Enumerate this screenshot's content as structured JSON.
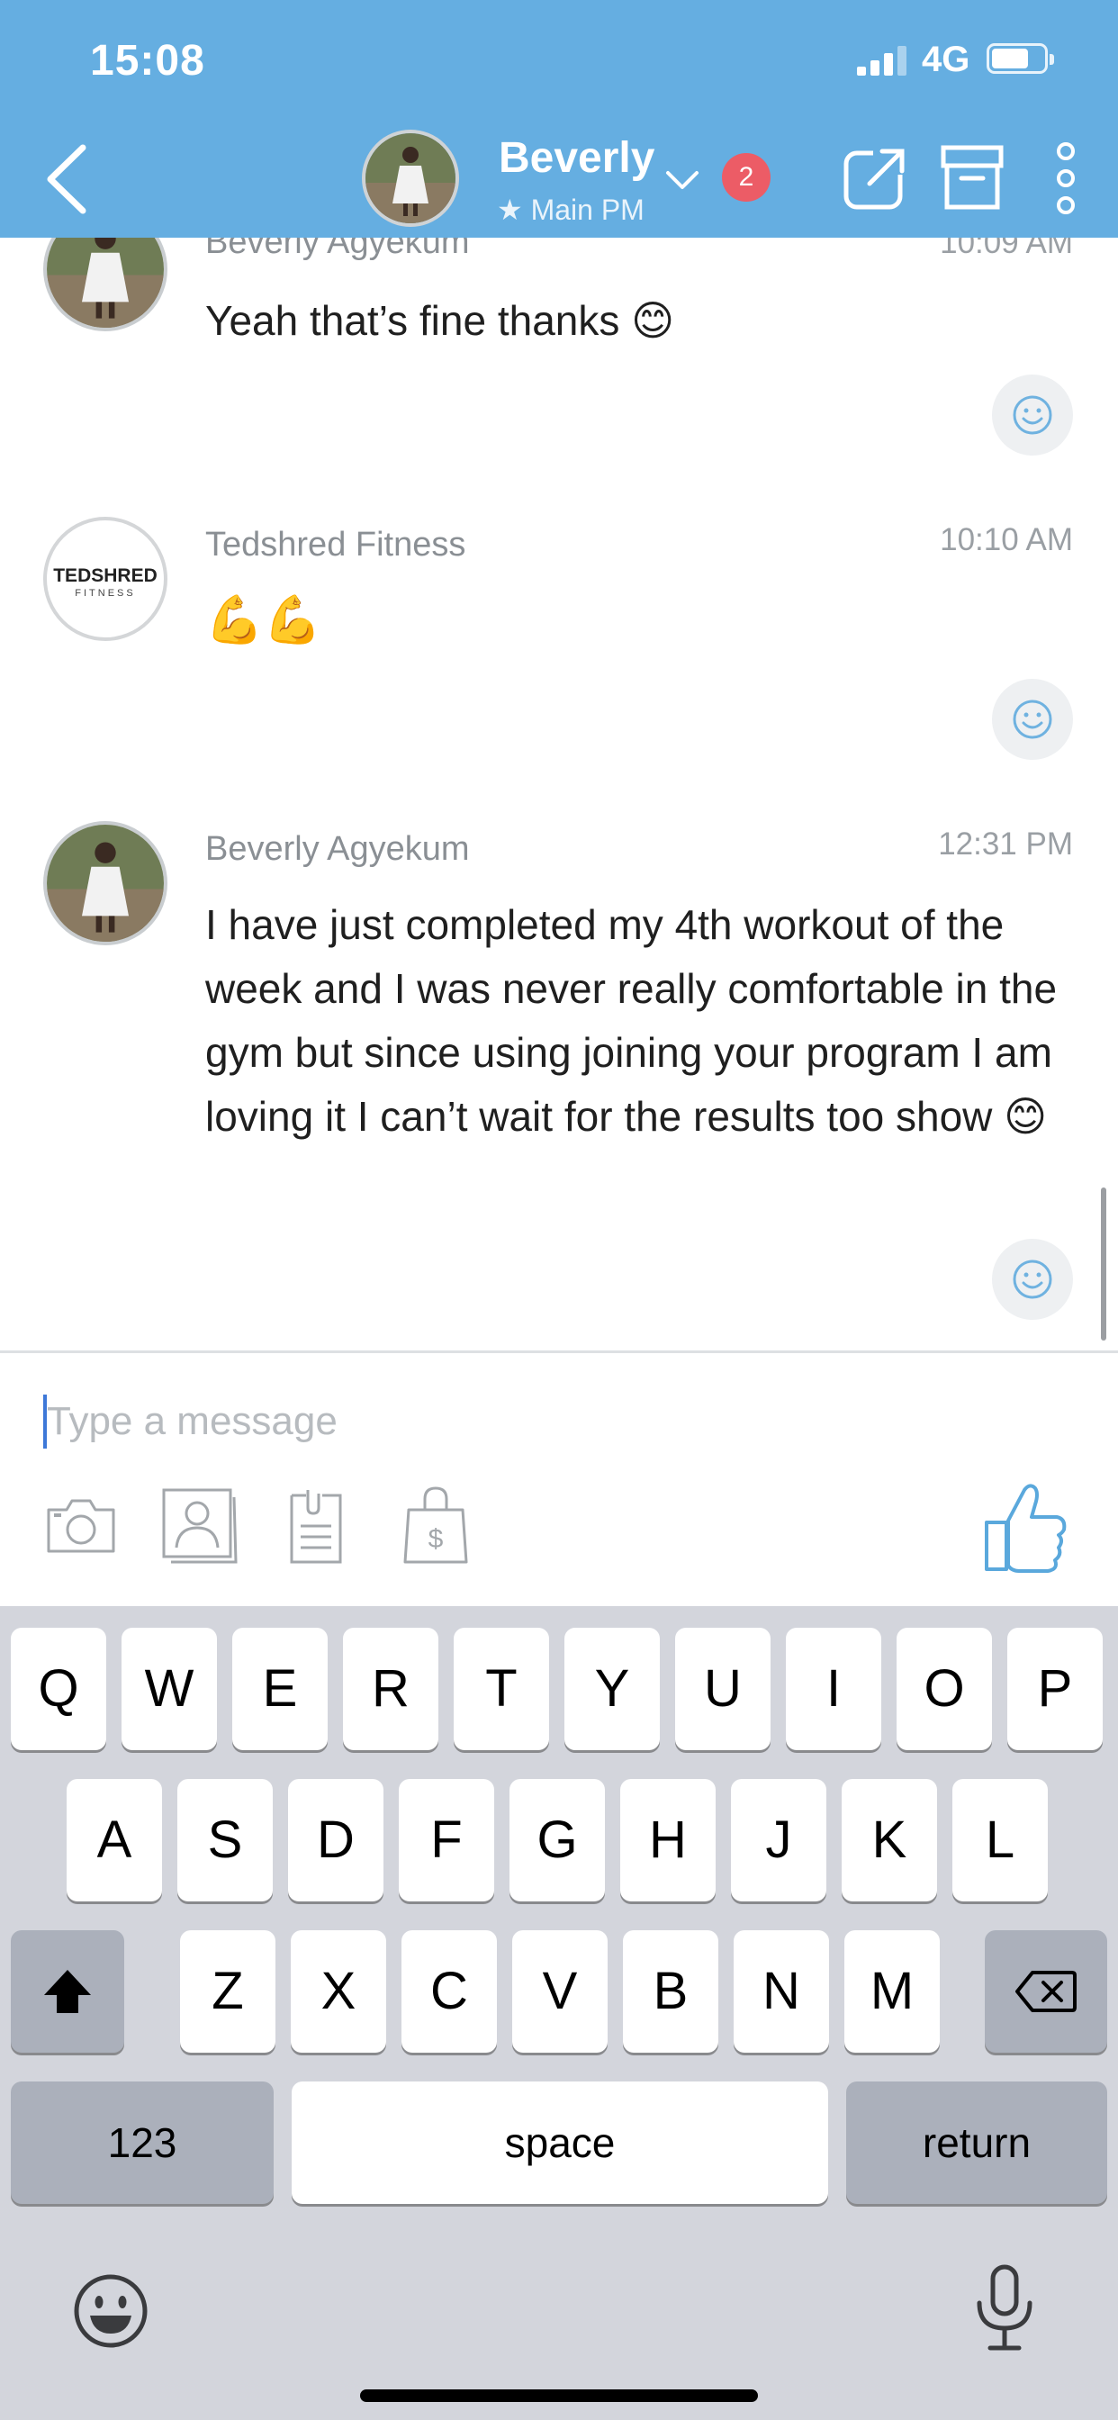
{
  "status_bar": {
    "time": "15:08",
    "network": "4G"
  },
  "header": {
    "name": "Beverly",
    "subtitle": "★ Main PM",
    "badge_count": "2",
    "icons": [
      "back-chevron-icon",
      "chevron-down-icon",
      "external-link-icon",
      "archive-icon",
      "more-vertical-icon"
    ],
    "bar_color": "#65aee1",
    "badge_color": "#ec5c66"
  },
  "messages": [
    {
      "sender": "Beverly Agyekum",
      "time": "10:09 AM",
      "text": "Yeah that’s fine thanks 😊"
    },
    {
      "sender": "Tedshred Fitness",
      "time": "10:10 AM",
      "text": "💪💪",
      "logo_text": "TEDSHRED",
      "logo_sub": "FITNESS"
    },
    {
      "sender": "Beverly Agyekum",
      "time": "12:31 PM",
      "text": "I have just completed my 4th workout of the week and I was never really comfortable in the gym but since using joining your program I am loving it I can’t wait for the results too show 😊"
    }
  ],
  "composer": {
    "placeholder": "Type a message",
    "tools": [
      "camera-icon",
      "contact-card-icon",
      "document-icon",
      "shopping-bag-dollar-icon",
      "thumbs-up-icon"
    ],
    "bag_symbol": "$",
    "accent_color": "#5aa8dc"
  },
  "keyboard": {
    "row1": [
      "Q",
      "W",
      "E",
      "R",
      "T",
      "Y",
      "U",
      "I",
      "O",
      "P"
    ],
    "row2": [
      "A",
      "S",
      "D",
      "F",
      "G",
      "H",
      "J",
      "K",
      "L"
    ],
    "row3": [
      "Z",
      "X",
      "C",
      "V",
      "B",
      "N",
      "M"
    ],
    "numbers_label": "123",
    "space_label": "space",
    "return_label": "return"
  }
}
